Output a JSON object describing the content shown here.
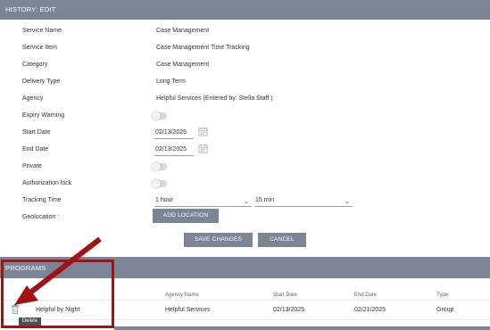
{
  "header": {
    "title": "HISTORY: EDIT"
  },
  "form": {
    "service_name": {
      "label": "Service Name",
      "value": "Case Management"
    },
    "service_item": {
      "label": "Service Item",
      "value": "Case Management Time Tracking"
    },
    "category": {
      "label": "Category",
      "value": "Case Management"
    },
    "delivery_type": {
      "label": "Delivery Type",
      "value": "Long Term"
    },
    "agency": {
      "label": "Agency",
      "value": "Helpful Services (Entered by: Stella Staff )"
    },
    "expiry_warning": {
      "label": "Expiry Warning",
      "on": false
    },
    "start_date": {
      "label": "Start Date",
      "value": "02/13/2025"
    },
    "end_date": {
      "label": "End Date",
      "value": "02/13/2025"
    },
    "private": {
      "label": "Private",
      "on": false
    },
    "authorization_lock": {
      "label": "Authorization lock",
      "on": false
    },
    "tracking_time": {
      "label": "Tracking Time",
      "hours": "1 hour",
      "minutes": "15 min"
    },
    "geolocation": {
      "label": "Geolocation :",
      "button": "ADD LOCATION"
    }
  },
  "actions": {
    "save": "SAVE CHANGES",
    "cancel": "CANCEL"
  },
  "programs": {
    "title": "PROGRAMS",
    "columns": [
      "Agency Name",
      "Start Date",
      "End Date",
      "Type"
    ],
    "rows": [
      {
        "name": "Helpful by Night",
        "agency": "Helpful Services",
        "start": "02/13/2025",
        "end": "02/21/2025",
        "type": "Group"
      }
    ],
    "delete_tooltip": "Delete"
  },
  "icons": {
    "calendar": "calendar-icon",
    "delete": "trash-icon",
    "select": "chevron-down-icon"
  },
  "colors": {
    "header_bg": "#7b8595",
    "annotation": "#a01313"
  }
}
